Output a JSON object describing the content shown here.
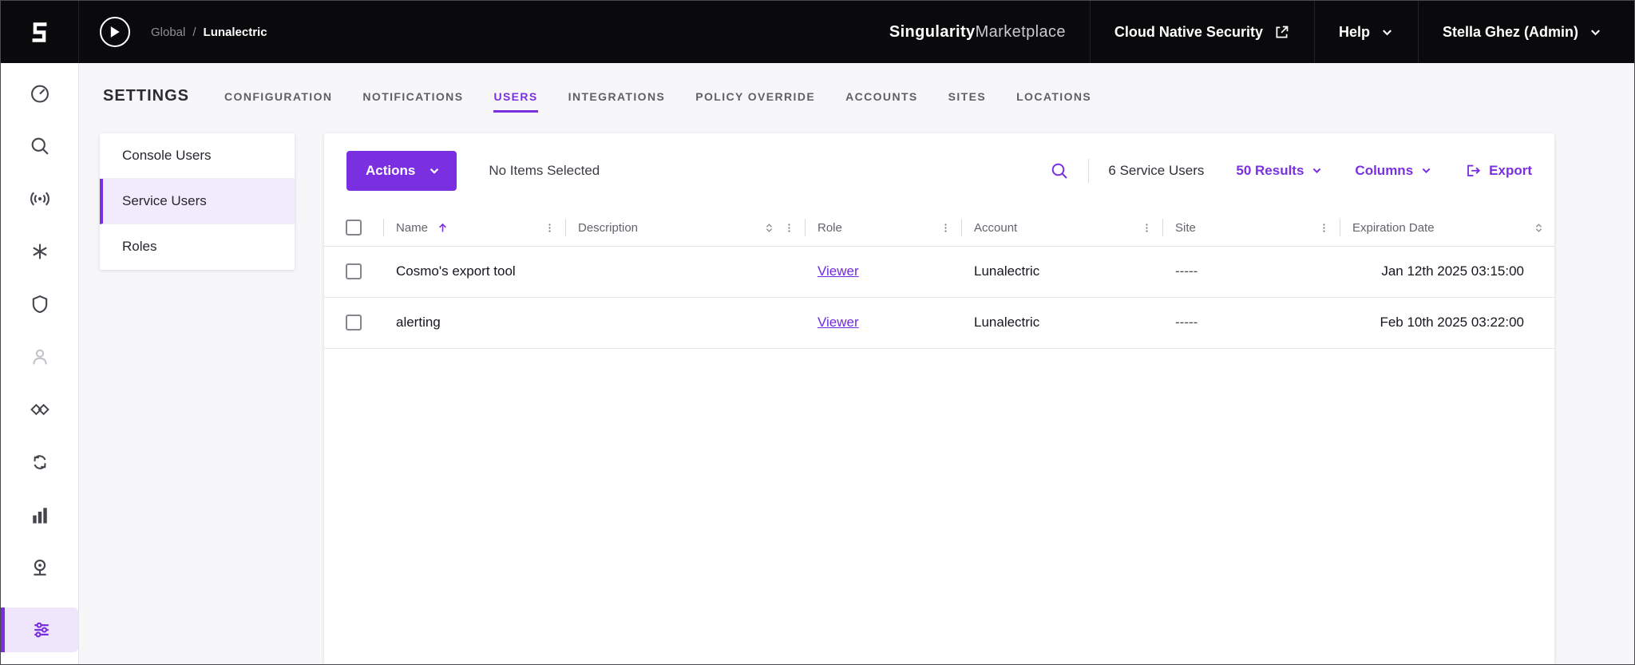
{
  "colors": {
    "accent": "#7A30E0",
    "accent_light": "#F2EBFC",
    "topbar_bg": "#0A0A0C",
    "link": "#6F2BD9"
  },
  "topbar": {
    "breadcrumb": {
      "root": "Global",
      "separator": "/",
      "current": "Lunalectric"
    },
    "brand": {
      "primary": "Singularity",
      "secondary": "Marketplace"
    },
    "product_link": "Cloud Native Security",
    "help_label": "Help",
    "user_label": "Stella Ghez (Admin)"
  },
  "sidebar": {
    "icons": [
      "gauge-icon",
      "search-icon",
      "broadcast-icon",
      "asterisk-icon",
      "shield-icon",
      "user-icon",
      "tags-icon",
      "sync-icon",
      "bar-chart-icon",
      "sensor-icon",
      "sliders-icon"
    ],
    "active_icon": "sliders-icon"
  },
  "settings": {
    "title": "SETTINGS",
    "tabs": [
      "CONFIGURATION",
      "NOTIFICATIONS",
      "USERS",
      "INTEGRATIONS",
      "POLICY OVERRIDE",
      "ACCOUNTS",
      "SITES",
      "LOCATIONS"
    ],
    "active_tab": "USERS",
    "subnav": [
      "Console Users",
      "Service Users",
      "Roles"
    ],
    "active_subnav": "Service Users"
  },
  "toolbar": {
    "actions_label": "Actions",
    "selection_status": "No Items Selected",
    "count_label": "6 Service Users",
    "results_label": "50 Results",
    "columns_label": "Columns",
    "export_label": "Export"
  },
  "table": {
    "headers": [
      "Name",
      "Description",
      "Role",
      "Account",
      "Site",
      "Expiration Date"
    ],
    "rows": [
      {
        "name": "Cosmo's export tool",
        "description": "",
        "role": "Viewer",
        "account": "Lunalectric",
        "site": "-----",
        "expiration": "Jan 12th 2025 03:15:00"
      },
      {
        "name": "alerting",
        "description": "",
        "role": "Viewer",
        "account": "Lunalectric",
        "site": "-----",
        "expiration": "Feb 10th 2025 03:22:00"
      }
    ]
  }
}
